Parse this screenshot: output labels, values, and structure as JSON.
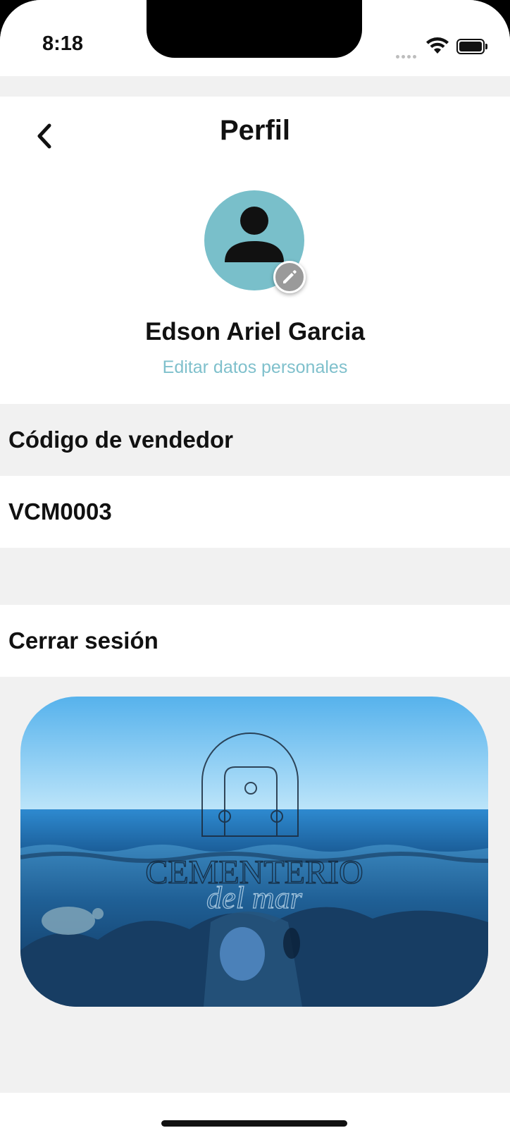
{
  "status_bar": {
    "time": "8:18"
  },
  "header": {
    "title": "Perfil",
    "back_icon": "chevron-left-icon"
  },
  "profile": {
    "avatar_color": "#79bfca",
    "name": "Edson Ariel Garcia",
    "edit_link": "Editar datos personales",
    "edit_icon": "pencil-icon"
  },
  "seller": {
    "label": "Código de vendedor",
    "code": "VCM0003"
  },
  "actions": {
    "logout_label": "Cerrar sesión"
  },
  "banner": {
    "brand_primary": "CEMENTERIO",
    "brand_secondary": "del mar"
  },
  "colors": {
    "accent": "#7fc0cc",
    "background": "#f1f1f1",
    "surface": "#ffffff",
    "text": "#111111"
  }
}
